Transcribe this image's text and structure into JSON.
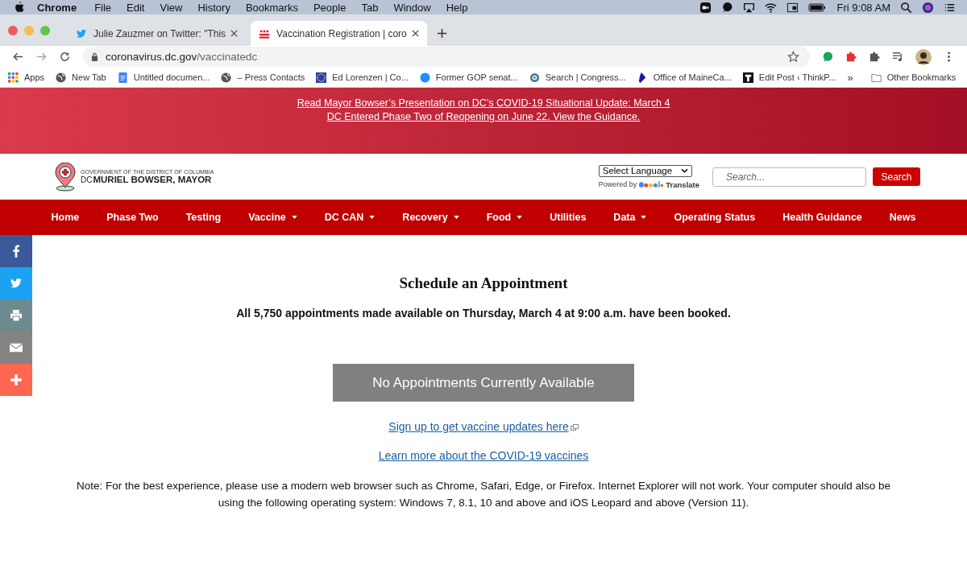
{
  "menu_bar": {
    "app": "Chrome",
    "items": [
      "File",
      "Edit",
      "View",
      "History",
      "Bookmarks",
      "People",
      "Tab",
      "Window",
      "Help"
    ],
    "clock": "Fri 9:08 AM"
  },
  "tabs": [
    {
      "title": "Julie Zauzmer on Twitter: \"This",
      "kind": "bird",
      "selected": false
    },
    {
      "title": "Vaccination Registration | coro",
      "kind": "flag",
      "selected": true
    }
  ],
  "address_bar": {
    "host": "coronavirus.dc.gov",
    "path": "/vaccinatedc"
  },
  "bookmarks": [
    {
      "label": "Apps",
      "kind": "grid"
    },
    {
      "label": "New Tab",
      "kind": "globe"
    },
    {
      "label": "Untitled documen...",
      "kind": "doc"
    },
    {
      "label": "– Press Contacts",
      "kind": "globe"
    },
    {
      "label": "Ed Lorenzen | Co...",
      "kind": "seal"
    },
    {
      "label": "Former GOP senat...",
      "kind": "dot"
    },
    {
      "label": "Search | Congress...",
      "kind": "ring"
    },
    {
      "label": "Office of MaineCa...",
      "kind": "maine"
    },
    {
      "label": "Edit Post ‹ ThinkP...",
      "kind": "tbox"
    }
  ],
  "bookmarks_more": "»",
  "other_bookmarks": "Other Bookmarks",
  "banner_links": [
    "Read Mayor Bowser’s Presentation on DC’s COVID-19 Situational Update: March 4",
    "DC Entered Phase Two of Reopening on June 22. View the Guidance."
  ],
  "logo": {
    "small": "GOVERNMENT OF THE DISTRICT OF COLUMBIA",
    "dc": "DC",
    "name": "MURIEL BOWSER, MAYOR"
  },
  "language_select": "Select Language",
  "powered_by": "Powered by",
  "translate": "Translate",
  "search": {
    "placeholder": "Search...",
    "button": "Search"
  },
  "nav": [
    {
      "label": "Home",
      "dropdown": false
    },
    {
      "label": "Phase Two",
      "dropdown": false
    },
    {
      "label": "Testing",
      "dropdown": false
    },
    {
      "label": "Vaccine",
      "dropdown": true
    },
    {
      "label": "DC CAN",
      "dropdown": true
    },
    {
      "label": "Recovery",
      "dropdown": true
    },
    {
      "label": "Food",
      "dropdown": true
    },
    {
      "label": "Utilities",
      "dropdown": false
    },
    {
      "label": "Data",
      "dropdown": true
    },
    {
      "label": "Operating Status",
      "dropdown": false
    },
    {
      "label": "Health Guidance",
      "dropdown": false
    },
    {
      "label": "News",
      "dropdown": false
    }
  ],
  "share": [
    {
      "kind": "facebook",
      "color": "#3b5998"
    },
    {
      "kind": "twitter",
      "color": "#1da1f2"
    },
    {
      "kind": "print",
      "color": "#6d8a8f"
    },
    {
      "kind": "email",
      "color": "#848484"
    },
    {
      "kind": "more",
      "color": "#fd6750"
    }
  ],
  "heading": "Schedule an Appointment",
  "notice": "All 5,750 appointments made available on Thursday, March 4 at 9:00 a.m. have been booked.",
  "status_button": "No Appointments Currently Available",
  "links": [
    {
      "text": "Sign up to get vaccine updates here",
      "external": true
    },
    {
      "text": "Learn more about the COVID-19 vaccines",
      "external": false
    }
  ],
  "note": "Note: For the best experience, please use a modern web browser such as Chrome, Safari, Edge, or Firefox. Internet Explorer will not work. Your computer should also be using the following operating system: Windows 7, 8.1, 10 and above and iOS Leopard and above (Version 11)."
}
